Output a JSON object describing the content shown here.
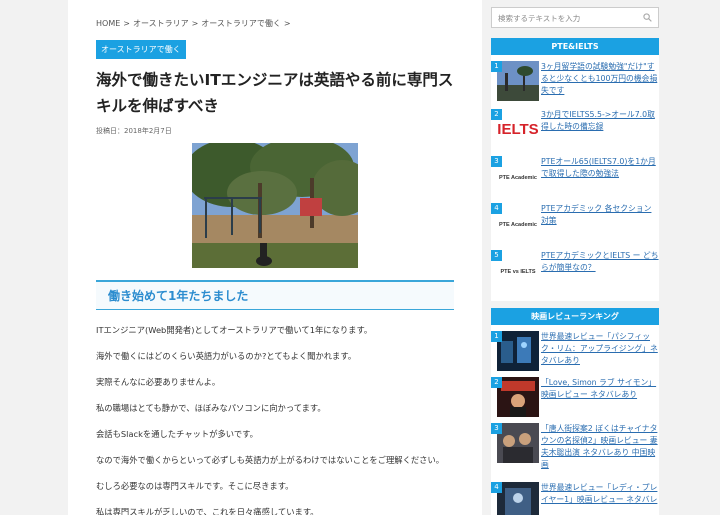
{
  "breadcrumb": [
    "HOME",
    ">",
    "オーストラリア",
    ">",
    "オーストラリアで働く",
    ">"
  ],
  "category": "オーストラリアで働く",
  "title": "海外で働きたいITエンジニアは英語やる前に専門スキルを伸ばすべき",
  "date": "投稿日：2018年2月7日",
  "section_heading": "働き始めて1年たちました",
  "paragraphs": [
    "ITエンジニア(Web開発者)としてオーストラリアで働いて1年になります。",
    "海外で働くにはどのくらい英語力がいるのか?とてもよく聞かれます。",
    "実際そんなに必要ありませんよ。",
    "私の職場はとても静かで、ほぼみなパソコンに向かってます。",
    "会話もSlackを通したチャットが多いです。",
    "なので海外で働くからといって必ずしも英語力が上がるわけではないことをご理解ください。",
    "むしろ必要なのは専門スキルです。そこに尽きます。",
    "私は専門スキルが乏しいので、これを日々痛感しています。"
  ],
  "search": {
    "placeholder": "検索するテキストを入力"
  },
  "widget1": {
    "title": "PTE&IELTS",
    "items": [
      {
        "num": "1",
        "text": "3ヶ月留学語の試験勉強\"だけ\"すると少なくとも100万円の機会損失です",
        "thumb": "photo"
      },
      {
        "num": "2",
        "text": "3か月でIELTS5.5->オール7.0取得した時の備忘録",
        "thumb": "IELTS"
      },
      {
        "num": "3",
        "text": "PTEオール65(IELTS7.0)を1か月で取得した際の勉強法",
        "thumb": "PTE Academic"
      },
      {
        "num": "4",
        "text": "PTEアカデミック 各セクション対策",
        "thumb": "PTE Academic"
      },
      {
        "num": "5",
        "text": "PTEアカデミックとIELTS ー どちらが簡単なの？",
        "thumb": "PTE vs IELTS"
      }
    ]
  },
  "widget2": {
    "title": "映画レビューランキング",
    "items": [
      {
        "num": "1",
        "text": "世界最速レビュー「パシフィック・リム：アップライジング」ネタバレあり"
      },
      {
        "num": "2",
        "text": "「Love, Simon ラブ サイモン」映画レビュー ネタバレあり"
      },
      {
        "num": "3",
        "text": "「唐人街探案2 ぼくはチャイナタウンの名探偵2」映画レビュー 妻夫木聡出演 ネタバレあり 中国映画"
      },
      {
        "num": "4",
        "text": "世界最速レビュー「レディ・プレイヤー1」映画レビュー ネタバレ"
      }
    ]
  },
  "colors": {
    "accent": "#1ba1e2",
    "link": "#2a6db0",
    "heading": "#2b8ccf"
  }
}
